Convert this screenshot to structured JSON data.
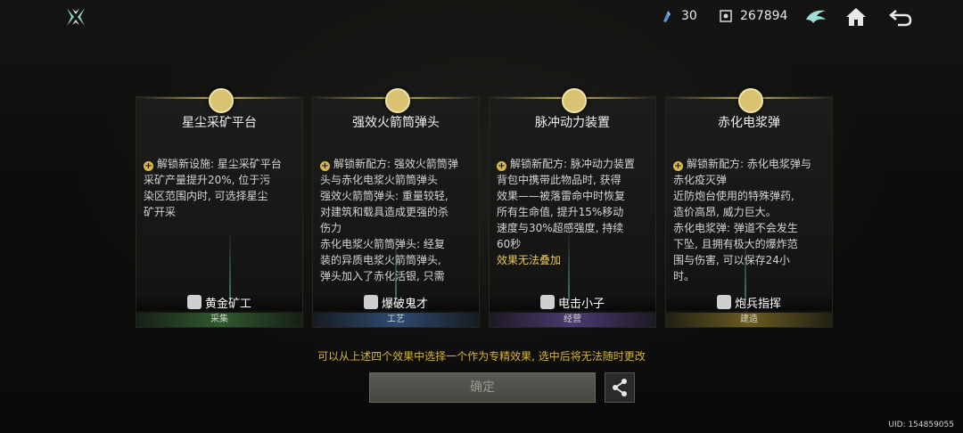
{
  "header": {
    "resource_1_value": "30",
    "resource_2_value": "267894"
  },
  "cards": [
    {
      "title": "星尘采矿平台",
      "desc_lines": [
        "解锁新设施: 星尘采矿平台",
        "采矿产量提升20%, 位于污",
        "染区范围内时, 可选择星尘",
        "矿开采"
      ],
      "skill": "黄金矿工",
      "category": "采集"
    },
    {
      "title": "强效火箭筒弹头",
      "desc_lines": [
        "解锁新配方: 强效火箭筒弹",
        "头与赤化电浆火箭筒弹头",
        "强效火箭筒弹头: 重量较轻,",
        "对建筑和载具造成更强的杀",
        "伤力",
        "赤化电浆火箭筒弹头: 经复",
        "装的异质电浆火箭筒弹头,",
        "弹头加入了赤化活银, 只需"
      ],
      "skill": "爆破鬼才",
      "category": "工艺"
    },
    {
      "title": "脉冲动力装置",
      "desc_lines": [
        "解锁新配方: 脉冲动力装置",
        "背包中携带此物品时, 获得",
        "效果——被落雷命中时恢复",
        "所有生命值, 提升15%移动",
        "速度与30%超感强度, 持续",
        "60秒"
      ],
      "desc_gold": "效果无法叠加",
      "skill": "电击小子",
      "category": "经营"
    },
    {
      "title": "赤化电浆弹",
      "desc_lines": [
        "解锁新配方: 赤化电浆弹与",
        "赤化疫灭弹",
        "近防炮台使用的特殊弹药,",
        "造价高昂, 威力巨大。",
        "赤化电浆弹: 弹道不会发生",
        "下坠, 且拥有极大的爆炸范",
        "围与伤害, 可以保存24小",
        "时。"
      ],
      "skill": "炮兵指挥",
      "category": "建造"
    }
  ],
  "notice": "可以从上述四个效果中选择一个作为专精效果, 选中后将无法随时更改",
  "confirm_label": "确定",
  "uid": "UID: 154859055",
  "colors": {
    "accent_gold": "#d9b437",
    "cat_green": "#2f5a2f",
    "cat_blue": "#2e4a72",
    "cat_purple": "#4c3a72",
    "cat_yellow": "#6b5c20"
  }
}
